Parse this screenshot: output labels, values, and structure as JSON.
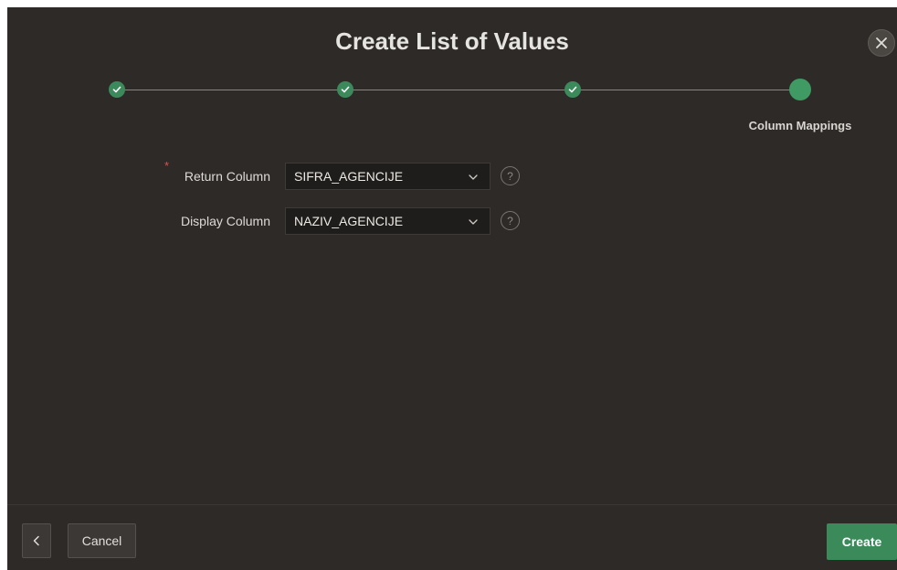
{
  "dialog": {
    "title": "Create List of Values",
    "close_icon": "close-icon"
  },
  "wizard": {
    "steps": [
      {
        "state": "complete",
        "icon": "check-icon"
      },
      {
        "state": "complete",
        "icon": "check-icon"
      },
      {
        "state": "complete",
        "icon": "check-icon"
      },
      {
        "state": "current",
        "label": "Column Mappings"
      }
    ]
  },
  "form": {
    "return_column": {
      "required_mark": "*",
      "label": "Return Column",
      "value": "SIFRA_AGENCIJE",
      "help": "?"
    },
    "display_column": {
      "label": "Display Column",
      "value": "NAZIV_AGENCIJE",
      "help": "?"
    }
  },
  "footer": {
    "back_icon": "chevron-left-icon",
    "cancel_label": "Cancel",
    "create_label": "Create"
  },
  "colors": {
    "dialog_bg": "#2d2a27",
    "accent_green": "#3a8a5a",
    "required_red": "#d9534f"
  }
}
